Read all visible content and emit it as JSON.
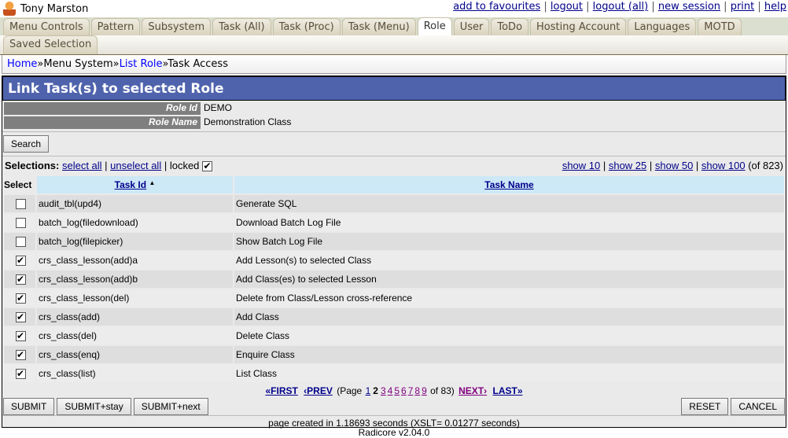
{
  "user": "Tony Marston",
  "top_links": [
    "add to favourites",
    "logout",
    "logout (all)",
    "new session",
    "print",
    "help"
  ],
  "tabs": [
    "Menu Controls",
    "Pattern",
    "Subsystem",
    "Task (All)",
    "Task (Proc)",
    "Task (Menu)",
    "Role",
    "User",
    "ToDo",
    "Hosting Account",
    "Languages",
    "MOTD"
  ],
  "active_tab": "Role",
  "tabs2": [
    "Saved Selection"
  ],
  "breadcrumb": {
    "home": "Home",
    "sep": "»",
    "menu": "Menu System",
    "list": "List Role",
    "current": "Task Access"
  },
  "title": "Link Task(s) to selected Role",
  "fields": {
    "role_id_label": "Role Id",
    "role_id": "DEMO",
    "role_name_label": "Role Name",
    "role_name": "Demonstration Class"
  },
  "search_label": "Search",
  "selections": {
    "label": "Selections:",
    "select_all": "select all",
    "unselect_all": "unselect all",
    "locked": "locked"
  },
  "show": {
    "s10": "show 10",
    "s25": "show 25",
    "s50": "show 50",
    "s100": "show 100",
    "total": "(of 823)"
  },
  "table": {
    "headers": [
      "Select",
      "Task Id",
      "Task Name"
    ],
    "rows": [
      {
        "checked": false,
        "id": "audit_tbl(upd4)",
        "name": "Generate SQL"
      },
      {
        "checked": false,
        "id": "batch_log(filedownload)",
        "name": "Download Batch Log File"
      },
      {
        "checked": false,
        "id": "batch_log(filepicker)",
        "name": "Show Batch Log File"
      },
      {
        "checked": true,
        "id": "crs_class_lesson(add)a",
        "name": "Add Lesson(s) to selected Class"
      },
      {
        "checked": true,
        "id": "crs_class_lesson(add)b",
        "name": "Add Class(es) to selected Lesson"
      },
      {
        "checked": true,
        "id": "crs_class_lesson(del)",
        "name": "Delete from Class/Lesson cross-reference"
      },
      {
        "checked": true,
        "id": "crs_class(add)",
        "name": "Add Class"
      },
      {
        "checked": true,
        "id": "crs_class(del)",
        "name": "Delete Class"
      },
      {
        "checked": true,
        "id": "crs_class(enq)",
        "name": "Enquire Class"
      },
      {
        "checked": true,
        "id": "crs_class(list)",
        "name": "List Class"
      }
    ]
  },
  "pagination": {
    "first": "«FIRST",
    "prev": "‹PREV",
    "page_label": "(Page",
    "pages": [
      "1",
      "2",
      "3",
      "4",
      "5",
      "6",
      "7",
      "8",
      "9"
    ],
    "current": "2",
    "of": "of 83)",
    "next": "NEXT›",
    "last": "LAST»"
  },
  "buttons": {
    "submit": "SUBMIT",
    "submit_stay": "SUBMIT+stay",
    "submit_next": "SUBMIT+next",
    "reset": "RESET",
    "cancel": "CANCEL"
  },
  "footer": "page created in 1.18693 seconds (XSLT= 0.01277 seconds)",
  "version": "Radicore v2.04.0"
}
